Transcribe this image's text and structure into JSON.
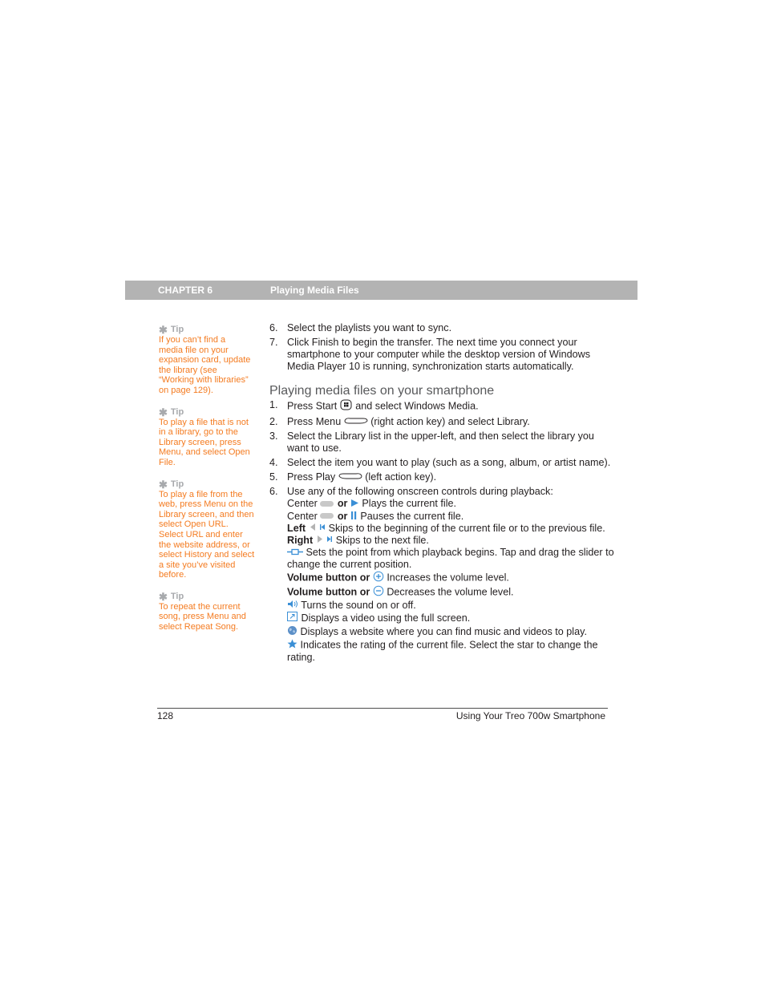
{
  "header": {
    "chapter": "CHAPTER 6",
    "title": "Playing Media Files"
  },
  "tips": [
    {
      "label": "Tip",
      "icon": "asterisk-icon",
      "text": "If you can’t find a media file on your expansion card, update the library (see “Working with libraries” on page 129)."
    },
    {
      "label": "Tip",
      "icon": "asterisk-icon",
      "text": "To play a file that is not in a library, go to the Library screen, press Menu, and select Open File."
    },
    {
      "label": "Tip",
      "icon": "asterisk-icon",
      "text": "To play a file from the web, press Menu on the Library screen, and then select Open URL. Select URL and enter the website address, or select History and select a site you’ve visited before."
    },
    {
      "label": "Tip",
      "icon": "asterisk-icon",
      "text": "To repeat the current song, press Menu and select Repeat Song."
    }
  ],
  "steps_top": [
    {
      "num": "6.",
      "text": "Select the playlists you want to sync."
    },
    {
      "num": "7.",
      "text": "Click Finish to begin the transfer. The next time you connect your smartphone to your computer while the desktop version of Windows Media Player 10 is running, synchronization starts automatically."
    }
  ],
  "section_title": "Playing media files on your smartphone",
  "steps": {
    "s1": {
      "num": "1.",
      "pre": "Press Start",
      "post": "and select Windows Media.",
      "icon": "windows-start-key-icon"
    },
    "s2": {
      "num": "2.",
      "pre": "Press Menu",
      "post": "(right action key) and select Library.",
      "icon": "right-action-key-icon"
    },
    "s3": {
      "num": "3.",
      "text": "Select the Library list in the upper-left, and then select the library you want to use."
    },
    "s4": {
      "num": "4.",
      "text": "Select the item you want to play (such as a song, album, or artist name)."
    },
    "s5": {
      "num": "5.",
      "pre": "Press Play",
      "post": "(left action key).",
      "icon": "left-action-key-icon"
    },
    "s6": {
      "num": "6.",
      "text": "Use any of the following onscreen controls during playback:"
    }
  },
  "controls": {
    "play": {
      "pre": "Center",
      "or": "or",
      "text": "Plays the current file."
    },
    "pause": {
      "pre": "Center",
      "or": "or",
      "text": "Pauses the current file."
    },
    "left": {
      "pre": "Left",
      "text": "Skips to the beginning of the current file or to the previous file."
    },
    "right": {
      "pre": "Right",
      "text": "Skips to the next file."
    },
    "slider": {
      "text": "Sets the point from which playback begins. Tap and drag the slider to change the current position."
    },
    "vol_up": {
      "pre": "Volume button or",
      "text": "Increases the volume level."
    },
    "vol_down": {
      "pre": "Volume button or",
      "text": "Decreases the volume level."
    },
    "mute": {
      "text": "Turns the sound on or off."
    },
    "fullscreen": {
      "text": "Displays a video using the full screen."
    },
    "web": {
      "text": "Displays a website where you can find music and videos to play."
    },
    "rating": {
      "text": "Indicates the rating of the current file. Select the star to change the rating."
    }
  },
  "footer": {
    "page_number": "128",
    "book_title": "Using Your Treo 700w Smartphone"
  },
  "colors": {
    "tip_text": "#f47b20",
    "tip_label": "#a7a9ac",
    "header_bar": "#b3b3b3",
    "icon_blue": "#3a8fd6"
  }
}
